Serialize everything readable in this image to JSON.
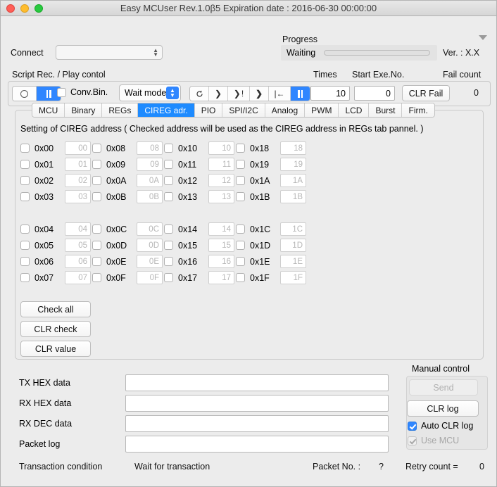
{
  "window": {
    "title": "Easy MCUser Rev.1.0β5   Expiration date : 2016-06-30 00:00:00",
    "accent_color": "#2f86ff",
    "background_color": "#ececec"
  },
  "top": {
    "connect_label": "Connect",
    "connect_value": "",
    "progress_label": "Progress",
    "progress_state": "Waiting",
    "progress_percent": 0,
    "version": "Ver. : X.X"
  },
  "script_control": {
    "section_label": "Script Rec. / Play contol",
    "times_label": "Times",
    "times_value": "10",
    "start_exe_label": "Start Exe.No.",
    "start_exe_value": "0",
    "fail_count_label": "Fail count",
    "fail_count_value": "0",
    "clr_fail_label": "CLR Fail",
    "conv_bin_label": "Conv.Bin.",
    "conv_bin_checked": false,
    "wait_mode_label": "Wait mode",
    "rec_segments": [
      {
        "icon": "record-circle-icon",
        "glyph": "○",
        "active": false
      },
      {
        "icon": "pause-icon",
        "glyph": "‖",
        "active": true
      }
    ],
    "play_segments": [
      {
        "icon": "loop-icon",
        "glyph": "↺",
        "active": false
      },
      {
        "icon": "step-icon",
        "glyph": "❯",
        "active": false
      },
      {
        "icon": "step-break-icon",
        "glyph": "❯ !",
        "active": false
      },
      {
        "icon": "play-icon",
        "glyph": "❯",
        "active": false
      },
      {
        "icon": "rewind-to-start-icon",
        "glyph": "|←",
        "active": false
      },
      {
        "icon": "pause-icon",
        "glyph": "‖",
        "active": true
      }
    ]
  },
  "tabs": [
    {
      "label": "MCU",
      "selected": false
    },
    {
      "label": "Binary",
      "selected": false
    },
    {
      "label": "REGs",
      "selected": false
    },
    {
      "label": "CIREG adr.",
      "selected": true
    },
    {
      "label": "PIO",
      "selected": false
    },
    {
      "label": "SPI/I2C",
      "selected": false
    },
    {
      "label": "Analog",
      "selected": false
    },
    {
      "label": "PWM",
      "selected": false
    },
    {
      "label": "LCD",
      "selected": false
    },
    {
      "label": "Burst",
      "selected": false
    },
    {
      "label": "Firm.",
      "selected": false
    }
  ],
  "panel": {
    "description": "Setting of CIREG address ( Checked address will be used as the CIREG address in REGs tab pannel. )",
    "addresses": [
      {
        "label": "0x00",
        "value": "00",
        "checked": false
      },
      {
        "label": "0x01",
        "value": "01",
        "checked": false
      },
      {
        "label": "0x02",
        "value": "02",
        "checked": false
      },
      {
        "label": "0x03",
        "value": "03",
        "checked": false
      },
      {
        "label": "0x08",
        "value": "08",
        "checked": false
      },
      {
        "label": "0x09",
        "value": "09",
        "checked": false
      },
      {
        "label": "0x0A",
        "value": "0A",
        "checked": false
      },
      {
        "label": "0x0B",
        "value": "0B",
        "checked": false
      },
      {
        "label": "0x10",
        "value": "10",
        "checked": false
      },
      {
        "label": "0x11",
        "value": "11",
        "checked": false
      },
      {
        "label": "0x12",
        "value": "12",
        "checked": false
      },
      {
        "label": "0x13",
        "value": "13",
        "checked": false
      },
      {
        "label": "0x18",
        "value": "18",
        "checked": false
      },
      {
        "label": "0x19",
        "value": "19",
        "checked": false
      },
      {
        "label": "0x1A",
        "value": "1A",
        "checked": false
      },
      {
        "label": "0x1B",
        "value": "1B",
        "checked": false
      },
      {
        "label": "0x04",
        "value": "04",
        "checked": false
      },
      {
        "label": "0x05",
        "value": "05",
        "checked": false
      },
      {
        "label": "0x06",
        "value": "06",
        "checked": false
      },
      {
        "label": "0x07",
        "value": "07",
        "checked": false
      },
      {
        "label": "0x0C",
        "value": "0C",
        "checked": false
      },
      {
        "label": "0x0D",
        "value": "0D",
        "checked": false
      },
      {
        "label": "0x0E",
        "value": "0E",
        "checked": false
      },
      {
        "label": "0x0F",
        "value": "0F",
        "checked": false
      },
      {
        "label": "0x14",
        "value": "14",
        "checked": false
      },
      {
        "label": "0x15",
        "value": "15",
        "checked": false
      },
      {
        "label": "0x16",
        "value": "16",
        "checked": false
      },
      {
        "label": "0x17",
        "value": "17",
        "checked": false
      },
      {
        "label": "0x1C",
        "value": "1C",
        "checked": false
      },
      {
        "label": "0x1D",
        "value": "1D",
        "checked": false
      },
      {
        "label": "0x1E",
        "value": "1E",
        "checked": false
      },
      {
        "label": "0x1F",
        "value": "1F",
        "checked": false
      }
    ],
    "buttons": [
      {
        "label": "Check all"
      },
      {
        "label": "CLR check"
      },
      {
        "label": "CLR value"
      }
    ]
  },
  "data_fields": [
    {
      "label": "TX HEX data",
      "value": ""
    },
    {
      "label": "RX HEX data",
      "value": ""
    },
    {
      "label": "RX DEC data",
      "value": ""
    },
    {
      "label": "Packet log",
      "value": ""
    }
  ],
  "manual_control": {
    "group_label": "Manual control",
    "send_label": "Send",
    "send_enabled": false,
    "clr_log_label": "CLR log",
    "auto_clr_log_label": "Auto CLR log",
    "auto_clr_log_checked": true,
    "use_mcu_label": "Use MCU",
    "use_mcu_checked": true,
    "use_mcu_enabled": false
  },
  "status": {
    "transaction_label": "Transaction condition",
    "transaction_value": "Wait for transaction",
    "packet_no_label": "Packet No. :",
    "packet_no_value": "?",
    "retry_label": "Retry count  =",
    "retry_value": "0"
  }
}
